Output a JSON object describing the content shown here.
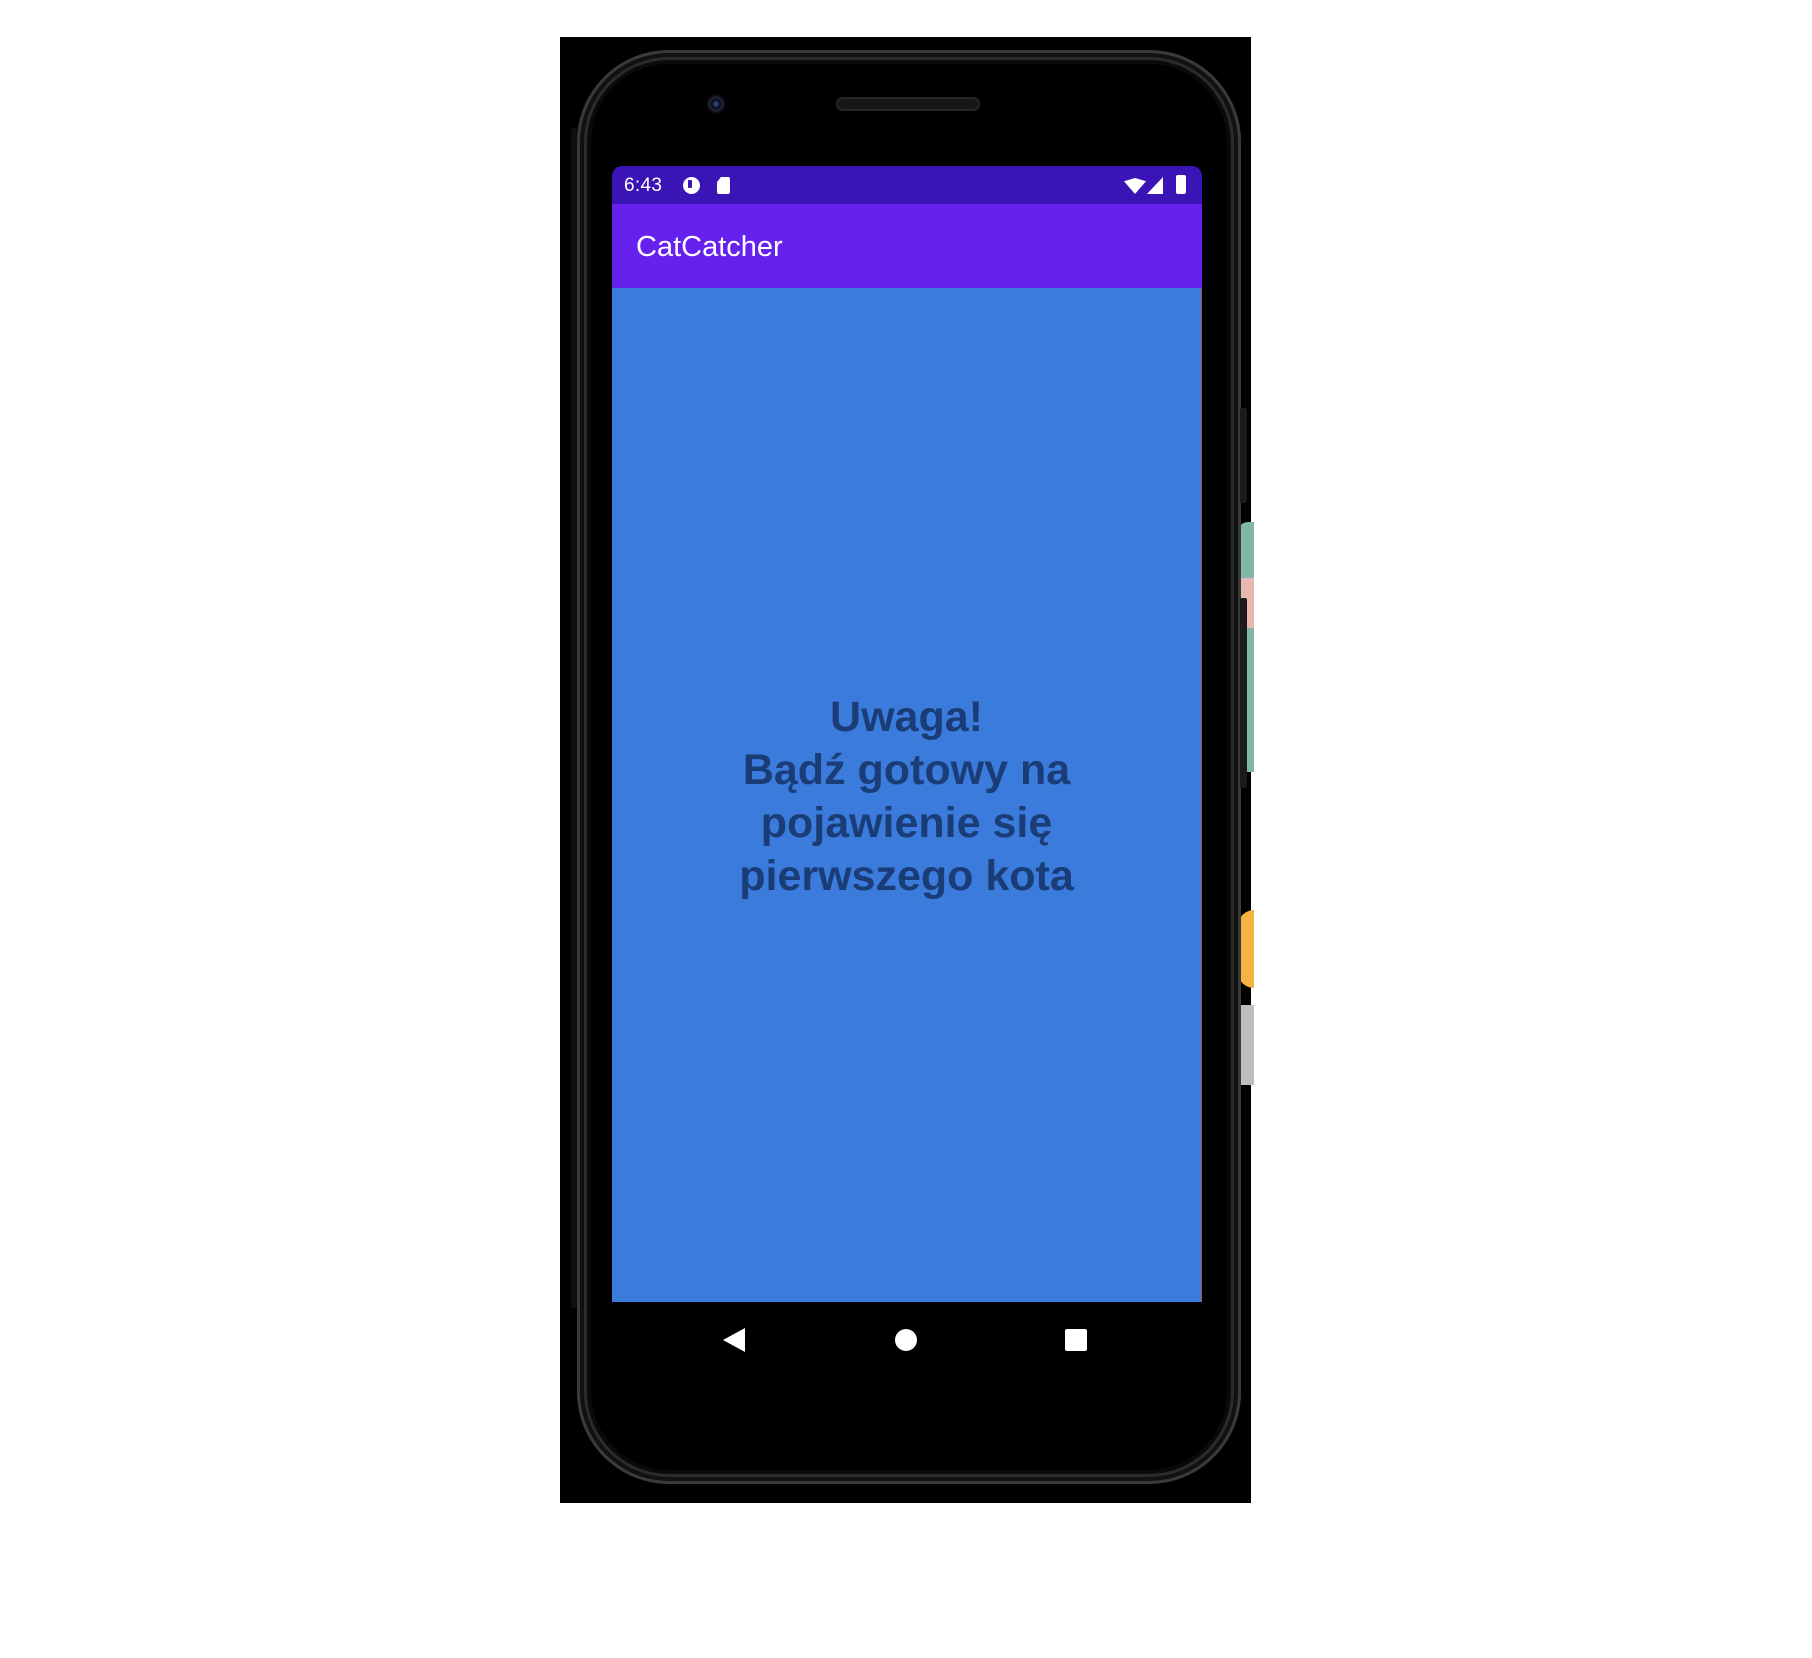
{
  "status_bar": {
    "time": "6:43",
    "icons": [
      "notification-p-icon",
      "sd-card-icon",
      "wifi-icon",
      "signal-icon",
      "battery-icon"
    ]
  },
  "app_bar": {
    "title": "CatCatcher"
  },
  "main": {
    "message_lines": [
      "Uwaga!",
      "Bądź gotowy na",
      "pojawienie się",
      "pierwszego kota"
    ]
  },
  "nav_bar": {
    "icons": [
      "back-icon",
      "home-icon",
      "recents-icon"
    ]
  },
  "colors": {
    "status_bar": "#3a14b4",
    "app_bar": "#6621ee",
    "content_background": "#3b7bdc",
    "message_text": "#1a3d78"
  }
}
